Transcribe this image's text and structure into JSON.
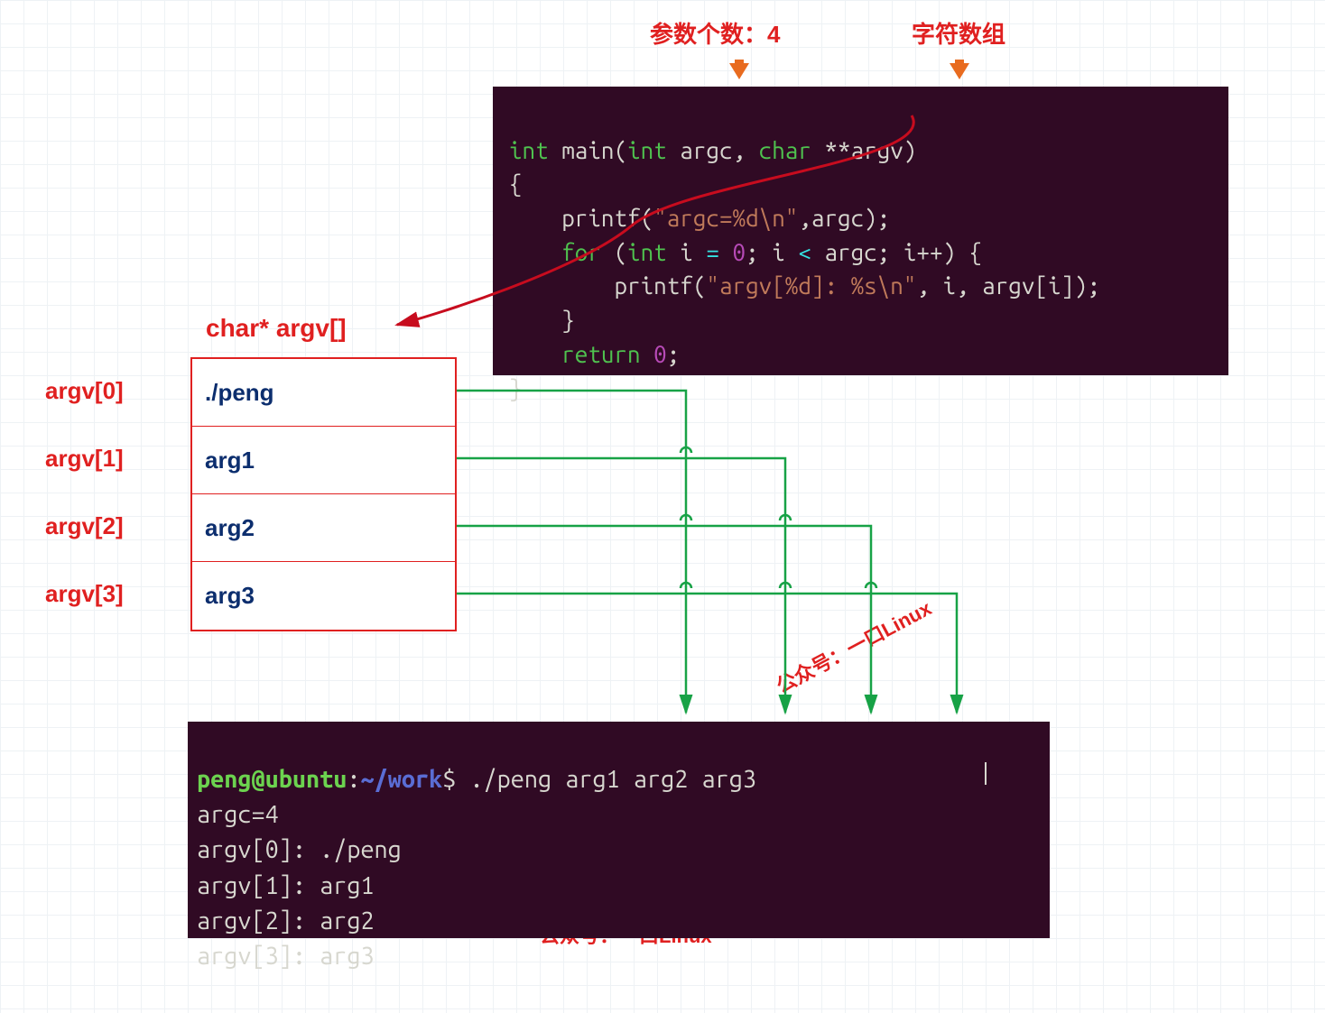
{
  "labels": {
    "argc_label": "参数个数：4",
    "argv_label": "字符数组",
    "char_argv": "char* argv[]"
  },
  "code": {
    "l1_int": "int",
    "l1_main": " main(",
    "l1_int2": "int",
    "l1_argc": " argc, ",
    "l1_char": "char",
    "l1_argv": " **argv)",
    "l2": "{",
    "l3_printf": "    printf(",
    "l3_str": "\"argc=%d\\n\"",
    "l3_rest": ",argc);",
    "l4_for": "    for",
    "l4_paren": " (",
    "l4_int": "int",
    "l4_i": " i ",
    "l4_eq": "=",
    "l4_sp": " ",
    "l4_zero": "0",
    "l4_semi": "; i ",
    "l4_lt": "<",
    "l4_rest": " argc; i++) {",
    "l5_printf": "        printf(",
    "l5_str": "\"argv[%d]: %s\\n\"",
    "l5_rest": ", i, argv[i]);",
    "l6": "    }",
    "l7_ret": "    return",
    "l7_sp": " ",
    "l7_zero": "0",
    "l7_semi": ";",
    "l8": "}"
  },
  "argv": {
    "idx0": "argv[0]",
    "idx1": "argv[1]",
    "idx2": "argv[2]",
    "idx3": "argv[3]",
    "v0": "./peng",
    "v1": "arg1",
    "v2": "arg2",
    "v3": "arg3"
  },
  "terminal": {
    "prompt_user": "peng@ubuntu",
    "prompt_sep": ":",
    "prompt_path": "~/work",
    "prompt_dollar": "$ ",
    "cmd": "./peng arg1 arg2 arg3",
    "out1": "argc=4",
    "out2": "argv[0]: ./peng",
    "out3": "argv[1]: arg1",
    "out4": "argv[2]: arg2",
    "out5": "argv[3]: arg3"
  },
  "watermark": "公众号：一口Linux"
}
